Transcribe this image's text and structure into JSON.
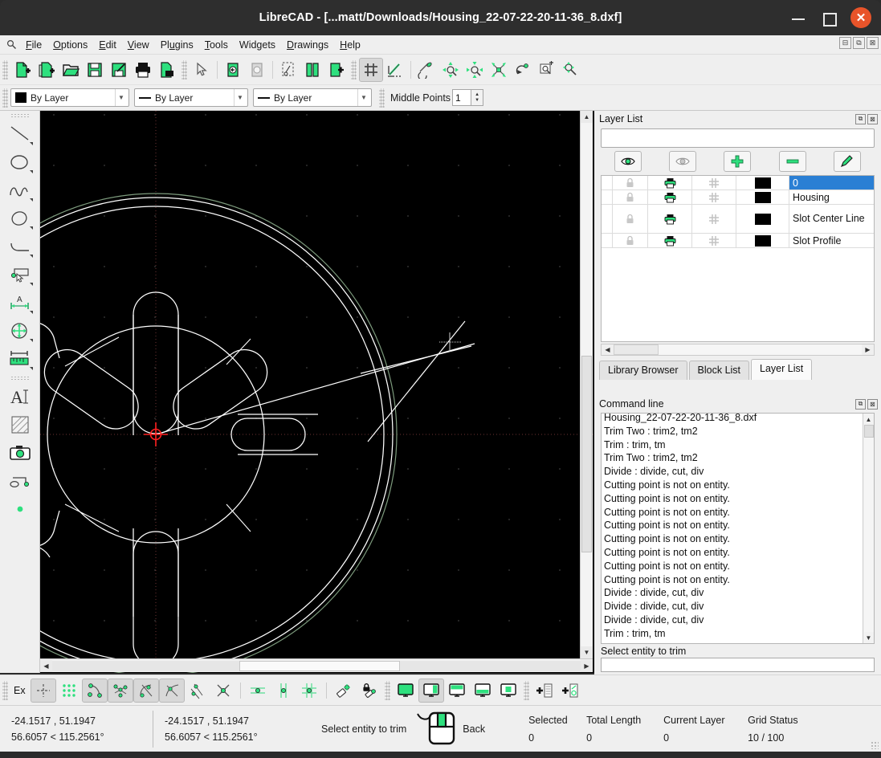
{
  "window": {
    "title": "LibreCAD - [...matt/Downloads/Housing_22-07-22-20-11-36_8.dxf]",
    "minimize": "–",
    "maximize": "□",
    "close": "✕"
  },
  "mdi_buttons": {
    "restore": "⊟",
    "maximize": "⧉",
    "close": "⊠"
  },
  "menubar": {
    "corner_icon": "app-icon",
    "items": [
      {
        "label": "File"
      },
      {
        "label": "Options"
      },
      {
        "label": "Edit"
      },
      {
        "label": "View"
      },
      {
        "label": "Plugins"
      },
      {
        "label": "Tools"
      },
      {
        "label": "Widgets"
      },
      {
        "label": "Drawings"
      },
      {
        "label": "Help"
      }
    ]
  },
  "toolbar_top": {
    "buttons": [
      {
        "name": "new-file-icon",
        "active": false
      },
      {
        "name": "new-from-template-icon",
        "active": false
      },
      {
        "name": "open-file-icon",
        "active": false
      },
      {
        "name": "save-icon",
        "active": false
      },
      {
        "name": "save-as-icon",
        "active": false
      },
      {
        "name": "print-icon",
        "active": false
      },
      {
        "name": "print-preview-icon",
        "active": false
      },
      {
        "name": "select-pointer-icon",
        "active": false
      },
      {
        "name": "undo-icon",
        "active": false
      },
      {
        "name": "redo-icon",
        "active": false
      },
      {
        "name": "cut-icon",
        "active": false
      },
      {
        "name": "copy-icon",
        "active": false
      },
      {
        "name": "paste-icon",
        "active": false
      },
      {
        "name": "grid-toggle-icon",
        "active": true
      },
      {
        "name": "draft-mode-icon",
        "active": false
      },
      {
        "name": "zoom-previous-icon",
        "active": false
      },
      {
        "name": "zoom-in-icon",
        "active": false
      },
      {
        "name": "zoom-out-icon",
        "active": false
      },
      {
        "name": "zoom-auto-icon",
        "active": false
      },
      {
        "name": "zoom-redraw-icon",
        "active": false
      },
      {
        "name": "zoom-window-icon",
        "active": false
      },
      {
        "name": "zoom-pan-icon",
        "active": false
      }
    ]
  },
  "toolbar_attributes": {
    "layer_color": {
      "value": "By Layer",
      "swatch": "#000000"
    },
    "line_width": {
      "value": "By Layer"
    },
    "line_type": {
      "value": "By Layer"
    },
    "middle_points_label": "Middle Points",
    "middle_points_value": "1"
  },
  "toolbar_left": {
    "buttons": [
      {
        "name": "line-tool-icon",
        "has_caret": true
      },
      {
        "name": "circle-tool-icon",
        "has_caret": true
      },
      {
        "name": "spline-tool-icon",
        "has_caret": true
      },
      {
        "name": "ellipse-tool-icon",
        "has_caret": true
      },
      {
        "name": "arc-tool-icon",
        "has_caret": true
      },
      {
        "name": "modify-select-icon",
        "has_caret": true
      },
      {
        "name": "dimension-tool-icon",
        "has_caret": true
      },
      {
        "name": "modify-move-rotate-icon",
        "has_caret": true
      },
      {
        "name": "info-measure-icon",
        "has_caret": true
      },
      {
        "name": "text-tool-icon",
        "has_caret": false
      },
      {
        "name": "hatch-tool-icon",
        "has_caret": false
      },
      {
        "name": "image-tool-icon",
        "has_caret": false
      },
      {
        "name": "polyline-tool-icon",
        "has_caret": false
      },
      {
        "name": "point-tool-icon",
        "has_caret": false
      }
    ]
  },
  "canvas": {
    "background": "#000000",
    "grid_dot_color": "#3a3a3a",
    "axis_color": "#6b3a3a",
    "entity_color": "#ffffff",
    "layer_highlight_color": "#7d9b7d",
    "cursor_color": "#ff2020"
  },
  "layer_panel": {
    "title": "Layer List",
    "filter_placeholder": "",
    "filter_value": "",
    "dock_buttons": {
      "float": "⧉",
      "close": "⊠"
    },
    "actions": [
      {
        "name": "show-all-layers-button",
        "icon": "eye-icon"
      },
      {
        "name": "hide-all-layers-button",
        "icon": "eye-dim-icon"
      },
      {
        "name": "add-layer-button",
        "icon": "plus-icon"
      },
      {
        "name": "remove-layer-button",
        "icon": "minus-icon"
      },
      {
        "name": "edit-layer-button",
        "icon": "pencil-icon"
      }
    ],
    "rows": [
      {
        "name": "0",
        "locked": false,
        "printable": true,
        "construction": false,
        "color": "#000000",
        "selected": true,
        "tall": false
      },
      {
        "name": "Housing",
        "locked": false,
        "printable": true,
        "construction": false,
        "color": "#000000",
        "selected": false,
        "tall": false
      },
      {
        "name": "Slot Center Line",
        "locked": false,
        "printable": true,
        "construction": false,
        "color": "#000000",
        "selected": false,
        "tall": true
      },
      {
        "name": "Slot Profile",
        "locked": false,
        "printable": true,
        "construction": false,
        "color": "#000000",
        "selected": false,
        "tall": false
      }
    ],
    "tabs": [
      {
        "label": "Library Browser",
        "active": false
      },
      {
        "label": "Block List",
        "active": false
      },
      {
        "label": "Layer List",
        "active": true
      }
    ]
  },
  "command_panel": {
    "title": "Command line",
    "dock_buttons": {
      "float": "⧉",
      "close": "⊠"
    },
    "history": [
      "Housing_22-07-22-20-11-36_8.dxf",
      "Trim Two : trim2, tm2",
      "Trim : trim, tm",
      "Trim Two : trim2, tm2",
      "Divide : divide, cut, div",
      "Cutting point is not on entity.",
      "Cutting point is not on entity.",
      "Cutting point is not on entity.",
      "Cutting point is not on entity.",
      "Cutting point is not on entity.",
      "Cutting point is not on entity.",
      "Cutting point is not on entity.",
      "Cutting point is not on entity.",
      "Divide : divide, cut, div",
      "Divide : divide, cut, div",
      "Divide : divide, cut, div",
      "Trim : trim, tm"
    ],
    "status_prompt": "Select entity to trim",
    "input_value": ""
  },
  "toolbar_bottom": {
    "ex_label": "Ex",
    "buttons": [
      {
        "name": "snap-free-icon",
        "on": true
      },
      {
        "name": "snap-grid-icon",
        "on": false
      },
      {
        "name": "snap-endpoint-icon",
        "on": true
      },
      {
        "name": "snap-entity-icon",
        "on": true
      },
      {
        "name": "snap-center-icon",
        "on": true
      },
      {
        "name": "snap-middle-icon",
        "on": true
      },
      {
        "name": "snap-distance-icon",
        "on": false
      },
      {
        "name": "snap-intersection-icon",
        "on": false
      },
      {
        "name": "restrict-horizontal-icon",
        "on": false
      },
      {
        "name": "restrict-vertical-icon",
        "on": false
      },
      {
        "name": "restrict-orthogonal-icon",
        "on": false
      },
      {
        "name": "relative-zero-icon",
        "on": false
      },
      {
        "name": "lock-relative-zero-icon",
        "on": false
      },
      {
        "name": "fullscreen-view-icon",
        "on": false
      },
      {
        "name": "split-view-icon",
        "on": true
      },
      {
        "name": "top-view-icon",
        "on": false
      },
      {
        "name": "bottom-view-icon",
        "on": false
      },
      {
        "name": "center-view-icon",
        "on": false
      },
      {
        "name": "add-layer-list-icon",
        "on": false
      },
      {
        "name": "add-entity-icon",
        "on": false
      }
    ]
  },
  "statusbar": {
    "absolute_coords": "-24.1517 , 51.1947",
    "absolute_polar": "56.6057 < 115.2561°",
    "relative_coords": "-24.1517 , 51.1947",
    "relative_polar": "56.6057 < 115.2561°",
    "action_prompt": "Select entity to trim",
    "mouse_hint": "Back",
    "fields": [
      {
        "label": "Selected",
        "value": "0"
      },
      {
        "label": "Total Length",
        "value": "0"
      },
      {
        "label": "Current Layer",
        "value": "0"
      },
      {
        "label": "Grid Status",
        "value": "10 / 100"
      }
    ]
  }
}
